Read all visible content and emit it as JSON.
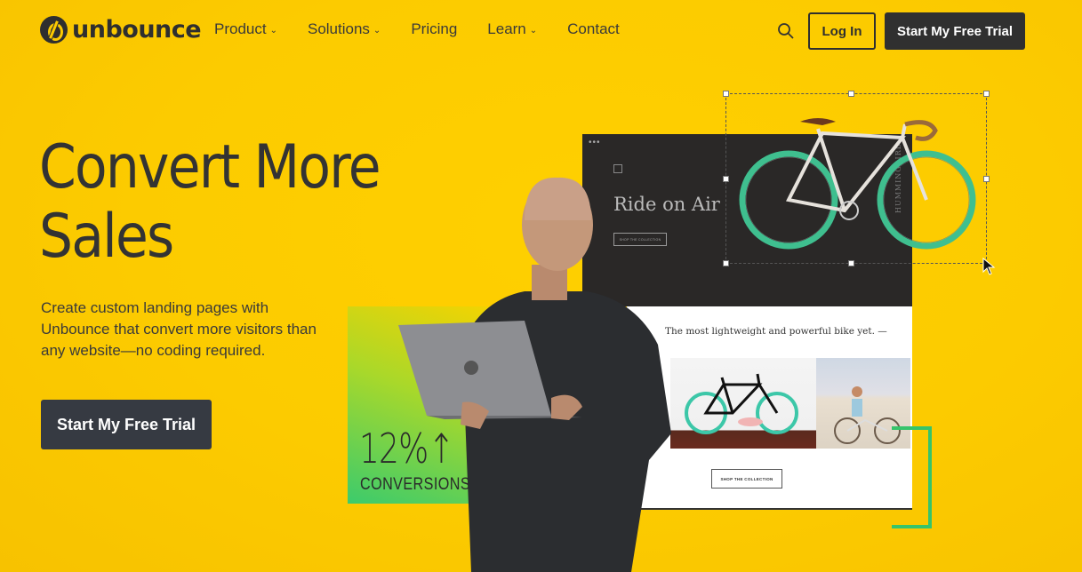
{
  "nav": {
    "brand": "unbounce",
    "menu": [
      {
        "label": "Product",
        "has_dropdown": true
      },
      {
        "label": "Solutions",
        "has_dropdown": true
      },
      {
        "label": "Pricing",
        "has_dropdown": false
      },
      {
        "label": "Learn",
        "has_dropdown": true
      },
      {
        "label": "Contact",
        "has_dropdown": false
      }
    ],
    "search_icon": "search-icon",
    "login_label": "Log In",
    "cta_label": "Start My Free Trial"
  },
  "hero": {
    "headline_line1": "Convert More",
    "headline_line2": "Sales",
    "subtext": "Create custom landing pages with Unbounce that convert more visitors than any website—no coding required.",
    "cta_label": "Start My Free Trial"
  },
  "visual": {
    "stat_value": "12%↑",
    "stat_label": "CONVERSIONS",
    "mock_page": {
      "dots": "•••",
      "title": "Ride on Air",
      "button1": "SHOP THE COLLECTION",
      "side_text": "HUMMINGBIRD",
      "tagline": "The most lightweight and powerful bike yet.  —",
      "button2": "SHOP THE COLLECTION"
    }
  },
  "colors": {
    "background": "#fccb00",
    "dark": "#303030",
    "hero_button": "#363a42",
    "accent_green": "#36c46b",
    "wheel_teal": "#3fbf8f"
  }
}
